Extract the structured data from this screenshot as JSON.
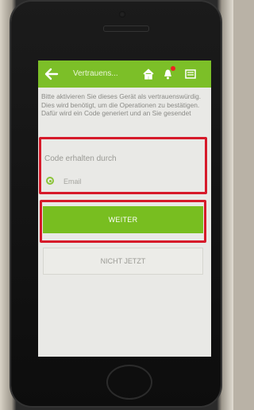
{
  "app": {
    "title": "Vertrauens..."
  },
  "content": {
    "info_text": "Bitte aktivieren Sie dieses Gerät als vertrauenswürdig. Dies wird benötigt, um die Operationen zu bestätigen. Dafür wird ein Code generiert und an Sie gesendet"
  },
  "code_section": {
    "title": "Code erhalten durch",
    "options": [
      {
        "label": "Email",
        "selected": true
      }
    ]
  },
  "buttons": {
    "primary": "WEITER",
    "secondary": "NICHT JETZT"
  },
  "colors": {
    "brand_green": "#7cbf28",
    "highlight_red": "#d61a2a"
  },
  "icons": [
    "back-arrow-icon",
    "home-icon",
    "bell-icon",
    "menu-icon"
  ]
}
